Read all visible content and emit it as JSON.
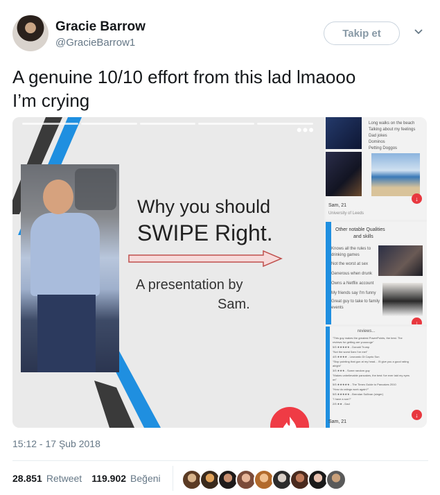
{
  "user": {
    "name": "Gracie Barrow",
    "handle": "@GracieBarrow1"
  },
  "follow_label": "Takip et",
  "tweet": {
    "line1": "A genuine 10/10 effort from this lad lmaooo",
    "line2": "I’m crying"
  },
  "slide": {
    "title_line1": "Why you should",
    "title_line2": "SWIPE Right.",
    "byline1": "A presentation by",
    "byline2": "Sam.",
    "menu_dots": "•••"
  },
  "side1": {
    "bullets": [
      "Long walks on the beach",
      "Talking about my feelings",
      "Dad jokes",
      "Dominos",
      "Petting Doggos"
    ],
    "name": "Sam, 21",
    "school": "University of Leeds"
  },
  "side2": {
    "title1": "Other notable Qualities",
    "title2": "and skills",
    "bullets": [
      "Knows all the rules to",
      "drinking games",
      "Not the worst at sex",
      "Generous when drunk",
      "Owns a Netflix account",
      "My friends say I'm funny",
      "Great guy to take to family",
      "events"
    ]
  },
  "side3": {
    "header": "reviews...",
    "reviews": [
      "\"This guy makes the greatest PowerPoints, the best. The",
      "reviews for getting are yuuuuuge\"",
      "5/5 ★★★★★ - Donald Trump",
      "\"Not the worst 5am I've met\"",
      "4/5 ★★★★ - Leonardo Di Caprio Sun",
      "\"Stop pointing that gun at my head... I'll give you a good rating",
      "alright\"",
      "3/5 ★★★ - Some random guy",
      "\"Makes unbelievable pancakes, the best I've ever laid my eyes",
      "on\"",
      "5/5 ★★★★★ - The Times Guide to Pancakes 2010",
      "\"How do ratings work again?\"",
      "5/5 ★★★★★ - Brendan Sullivan (singer)",
      "\"I have a son?\"",
      "2/5 ★★ - Dad"
    ],
    "name": "Sam, 21"
  },
  "timestamp": "15:12 - 17 Şub 2018",
  "stats": {
    "retweets": "28.851",
    "retweet_label": "Retweet",
    "likes": "119.902",
    "like_label": "Beğeni"
  },
  "colors": {
    "accent_blue": "#1da1f2",
    "tinder_red": "#ef3b45",
    "slide_blue": "#1f8fe0",
    "text_gray": "#657786"
  },
  "icons": {
    "dropdown": "chevron-down-icon",
    "more": "more-dots-icon",
    "tinder": "tinder-flame-icon"
  }
}
